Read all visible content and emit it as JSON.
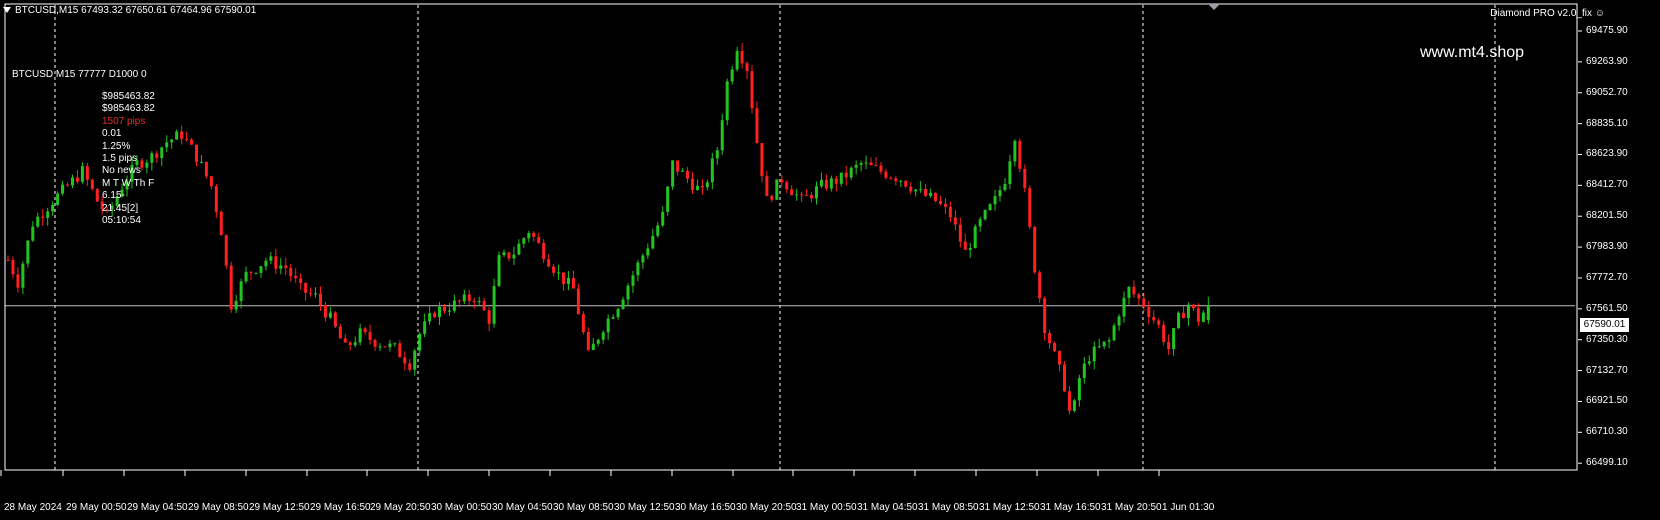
{
  "header": {
    "symbol_line": "BTCUSD,M15  67493.32 67650.61 67464.96 67590.01",
    "indicator_name": "Diamond PRO v2.0_fix"
  },
  "watermark": "www.mt4.shop",
  "info_panel": {
    "line1": "BTCUSD M15 77777  D1000 0",
    "lines": [
      {
        "text": "$985463.82",
        "color": "#ffffff"
      },
      {
        "text": "$985463.82",
        "color": "#ffffff"
      },
      {
        "text": "1507 pips",
        "color": "#e03030"
      },
      {
        "text": "0.01",
        "color": "#ffffff"
      },
      {
        "text": "1.25%",
        "color": "#ffffff"
      },
      {
        "text": "1.5 pips",
        "color": "#ffffff"
      },
      {
        "text": "No news",
        "color": "#ffffff"
      },
      {
        "text": "M T W Th F",
        "color": "#ffffff"
      },
      {
        "text": "6.15-21.45[2]",
        "color": "#ffffff"
      },
      {
        "text": "05:10:54",
        "color": "#ffffff"
      }
    ]
  },
  "price_axis": [
    "69475.90",
    "69263.90",
    "69052.70",
    "68835.10",
    "68623.90",
    "68412.70",
    "68201.50",
    "67983.90",
    "67772.70",
    "67561.50",
    "67350.30",
    "67132.70",
    "66921.50",
    "66710.30",
    "66499.10"
  ],
  "current_price": "67590.01",
  "time_axis": [
    "28 May 2024",
    "29 May 00:50",
    "29 May 04:50",
    "29 May 08:50",
    "29 May 12:50",
    "29 May 16:50",
    "29 May 20:50",
    "30 May 00:50",
    "30 May 04:50",
    "30 May 08:50",
    "30 May 12:50",
    "30 May 16:50",
    "30 May 20:50",
    "31 May 00:50",
    "31 May 04:50",
    "31 May 08:50",
    "31 May 12:50",
    "31 May 16:50",
    "31 May 20:50",
    "1 Jun 01:30"
  ],
  "colors": {
    "bull": "#22c322",
    "bear": "#ff2020",
    "background": "#000000",
    "grid": "#ffffff",
    "axis": "#ffffff"
  },
  "chart_data": {
    "type": "candlestick",
    "symbol": "BTCUSD",
    "timeframe": "M15",
    "ylim": [
      66499.1,
      69475.9
    ],
    "last": {
      "open": 67493.32,
      "high": 67650.61,
      "low": 67464.96,
      "close": 67590.01
    },
    "close_path": [
      [
        0,
        67900
      ],
      [
        10,
        67750
      ],
      [
        25,
        68150
      ],
      [
        45,
        68300
      ],
      [
        60,
        68400
      ],
      [
        75,
        68500
      ],
      [
        90,
        68300
      ],
      [
        100,
        68200
      ],
      [
        115,
        68400
      ],
      [
        130,
        68550
      ],
      [
        145,
        68600
      ],
      [
        160,
        68700
      ],
      [
        175,
        68750
      ],
      [
        190,
        68600
      ],
      [
        205,
        68400
      ],
      [
        215,
        68100
      ],
      [
        225,
        67600
      ],
      [
        240,
        67800
      ],
      [
        260,
        67900
      ],
      [
        280,
        67850
      ],
      [
        295,
        67700
      ],
      [
        310,
        67650
      ],
      [
        325,
        67500
      ],
      [
        340,
        67300
      ],
      [
        355,
        67400
      ],
      [
        370,
        67350
      ],
      [
        390,
        67300
      ],
      [
        405,
        67200
      ],
      [
        415,
        67400
      ],
      [
        430,
        67550
      ],
      [
        450,
        67600
      ],
      [
        470,
        67650
      ],
      [
        485,
        67500
      ],
      [
        495,
        67900
      ],
      [
        510,
        67950
      ],
      [
        525,
        68100
      ],
      [
        540,
        67950
      ],
      [
        555,
        67800
      ],
      [
        570,
        67700
      ],
      [
        585,
        67250
      ],
      [
        600,
        67450
      ],
      [
        615,
        67600
      ],
      [
        630,
        67800
      ],
      [
        645,
        68000
      ],
      [
        660,
        68200
      ],
      [
        670,
        68550
      ],
      [
        685,
        68450
      ],
      [
        700,
        68350
      ],
      [
        715,
        68650
      ],
      [
        725,
        69100
      ],
      [
        735,
        69350
      ],
      [
        745,
        69200
      ],
      [
        755,
        68700
      ],
      [
        765,
        68300
      ],
      [
        780,
        68450
      ],
      [
        800,
        68300
      ],
      [
        820,
        68400
      ],
      [
        840,
        68450
      ],
      [
        860,
        68550
      ],
      [
        880,
        68500
      ],
      [
        900,
        68450
      ],
      [
        920,
        68350
      ],
      [
        935,
        68300
      ],
      [
        950,
        68200
      ],
      [
        965,
        67950
      ],
      [
        980,
        68150
      ],
      [
        995,
        68300
      ],
      [
        1005,
        68450
      ],
      [
        1015,
        68750
      ],
      [
        1025,
        68350
      ],
      [
        1035,
        67850
      ],
      [
        1045,
        67450
      ],
      [
        1055,
        67250
      ],
      [
        1065,
        67050
      ],
      [
        1072,
        66800
      ],
      [
        1080,
        67100
      ],
      [
        1090,
        67250
      ],
      [
        1100,
        67300
      ],
      [
        1110,
        67350
      ],
      [
        1120,
        67550
      ],
      [
        1130,
        67700
      ],
      [
        1145,
        67600
      ],
      [
        1160,
        67450
      ],
      [
        1170,
        67300
      ],
      [
        1180,
        67500
      ],
      [
        1190,
        67600
      ],
      [
        1200,
        67500
      ],
      [
        1210,
        67590
      ]
    ]
  }
}
